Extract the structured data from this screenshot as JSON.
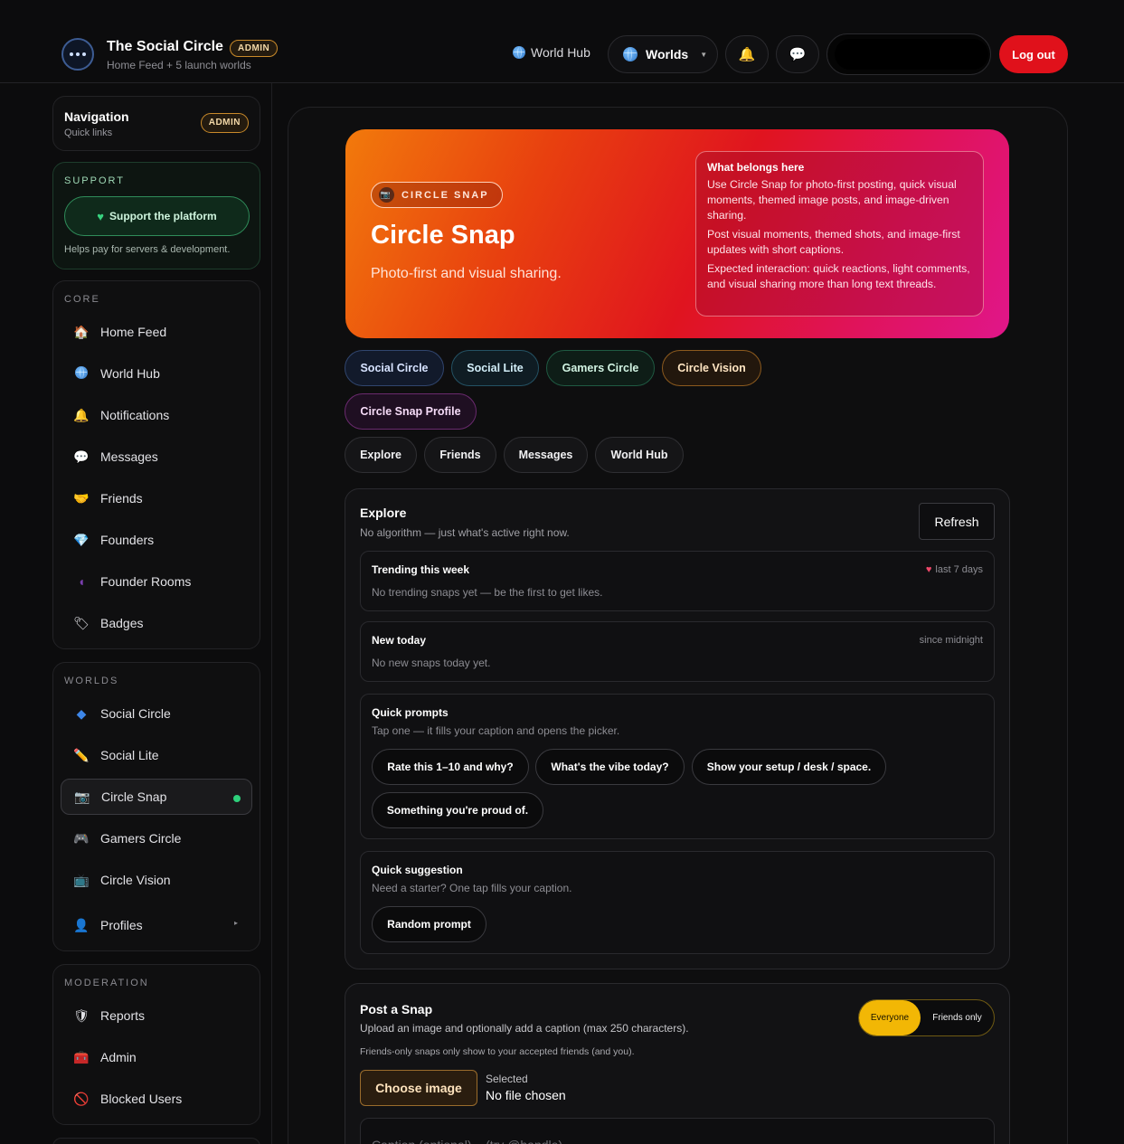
{
  "header": {
    "brand_title": "The Social Circle",
    "brand_badge": "ADMIN",
    "brand_subtitle": "Home Feed + 5 launch worlds",
    "world_hub_link": "World Hub",
    "worlds_label": "Worlds",
    "logout_label": "Log out"
  },
  "sidebar": {
    "nav_title": "Navigation",
    "nav_subtitle": "Quick links",
    "nav_badge": "ADMIN",
    "support": {
      "heading": "SUPPORT",
      "button_label": "Support the platform",
      "note": "Helps pay for servers & development."
    },
    "core": {
      "heading": "CORE",
      "items": [
        {
          "label": "Home Feed",
          "icon": "house-icon"
        },
        {
          "label": "World Hub",
          "icon": "globe-icon"
        },
        {
          "label": "Notifications",
          "icon": "bell-icon"
        },
        {
          "label": "Messages",
          "icon": "speech-bubble-icon"
        },
        {
          "label": "Friends",
          "icon": "handshake-icon"
        },
        {
          "label": "Founders",
          "icon": "gem-icon"
        },
        {
          "label": "Founder Rooms",
          "icon": "door-icon"
        },
        {
          "label": "Badges",
          "icon": "label-icon"
        }
      ]
    },
    "worlds": {
      "heading": "WORLDS",
      "items": [
        {
          "label": "Social Circle",
          "icon": "blue-diamond-icon"
        },
        {
          "label": "Social Lite",
          "icon": "pencil-icon"
        },
        {
          "label": "Circle Snap",
          "icon": "camera-icon",
          "active": true
        },
        {
          "label": "Gamers Circle",
          "icon": "gamepad-icon"
        },
        {
          "label": "Circle Vision",
          "icon": "tv-icon"
        },
        {
          "label": "Profiles",
          "icon": "person-icon"
        }
      ]
    },
    "moderation": {
      "heading": "MODERATION",
      "items": [
        {
          "label": "Reports",
          "icon": "shield-icon"
        },
        {
          "label": "Admin",
          "icon": "toolbox-icon"
        },
        {
          "label": "Blocked Users",
          "icon": "no-entry-icon"
        }
      ]
    }
  },
  "hero": {
    "chip": "CIRCLE SNAP",
    "title": "Circle Snap",
    "subtitle": "Photo-first and visual sharing.",
    "box_title": "What belongs here",
    "box_p1": "Use Circle Snap for photo-first posting, quick visual moments, themed image posts, and image-driven sharing.",
    "box_p2": "Post visual moments, themed shots, and image-first updates with short captions.",
    "box_p3": "Expected interaction: quick reactions, light comments, and visual sharing more than long text threads."
  },
  "world_chips": [
    "Social Circle",
    "Social Lite",
    "Gamers Circle",
    "Circle Vision",
    "Circle Snap Profile"
  ],
  "action_chips": [
    "Explore",
    "Friends",
    "Messages",
    "World Hub"
  ],
  "explore": {
    "title": "Explore",
    "subtitle": "No algorithm — just what's active right now.",
    "refresh_label": "Refresh",
    "trending": {
      "title": "Trending this week",
      "meta": "last 7 days",
      "empty": "No trending snaps yet — be the first to get likes."
    },
    "new_today": {
      "title": "New today",
      "meta": "since midnight",
      "empty": "No new snaps today yet."
    },
    "quick_prompts": {
      "title": "Quick prompts",
      "subtitle": "Tap one — it fills your caption and opens the picker.",
      "prompts": [
        "Rate this 1–10 and why?",
        "What's the vibe today?",
        "Show your setup / desk / space.",
        "Something you're proud of."
      ]
    },
    "quick_suggestion": {
      "title": "Quick suggestion",
      "subtitle": "Need a starter? One tap fills your caption.",
      "button": "Random prompt"
    }
  },
  "post": {
    "title": "Post a Snap",
    "subtitle": "Upload an image and optionally add a caption (max 250 characters).",
    "note": "Friends-only snaps only show to your accepted friends (and you).",
    "visibility_on": "Everyone",
    "visibility_off": "Friends only",
    "choose_label": "Choose image",
    "selected_label": "Selected",
    "selected_value": "No file chosen",
    "caption_placeholder": "Caption (optional)... (try @handle)"
  }
}
